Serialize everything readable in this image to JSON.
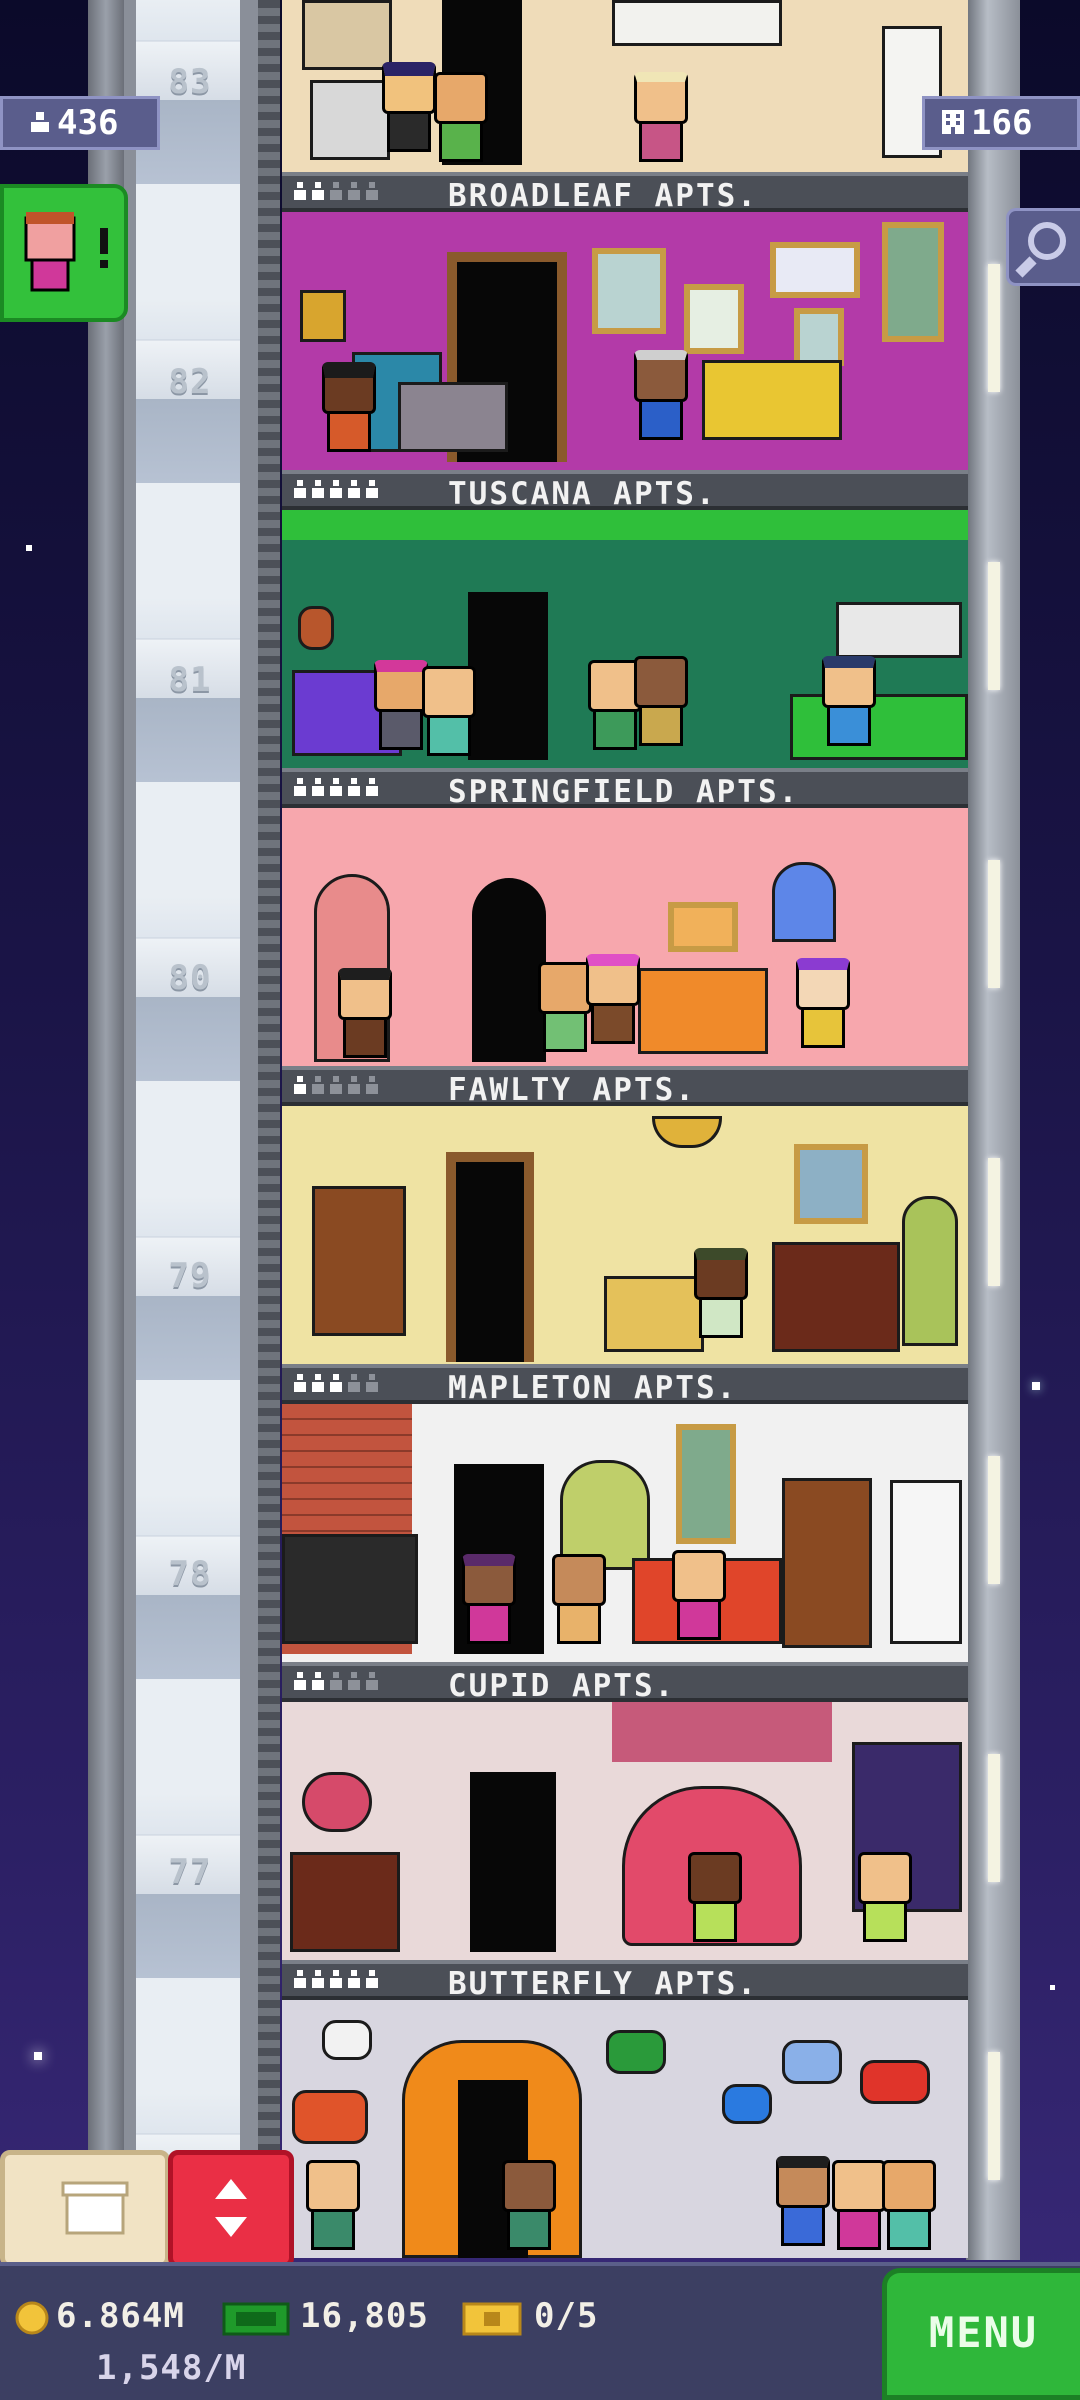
{
  "hud": {
    "population": "436",
    "floor_count": "166"
  },
  "floors": [
    {
      "number": "83",
      "name": "BROADLEAF APTS.",
      "residents": 2
    },
    {
      "number": "82",
      "name": "TUSCANA APTS.",
      "residents": 5
    },
    {
      "number": "81",
      "name": "SPRINGFIELD APTS.",
      "residents": 5
    },
    {
      "number": "80",
      "name": "FAWLTY APTS.",
      "residents": 1
    },
    {
      "number": "79",
      "name": "MAPLETON APTS.",
      "residents": 3
    },
    {
      "number": "78",
      "name": "CUPID APTS.",
      "residents": 2
    },
    {
      "number": "77",
      "name": "BUTTERFLY APTS.",
      "residents": 5
    }
  ],
  "bottom_bar": {
    "coins": "6.864M",
    "income": "1,548/M",
    "bux": "16,805",
    "tickets": "0/5",
    "menu_label": "MENU"
  },
  "colors": {
    "accent_green": "#33c13b",
    "elevator_red": "#ea2f45",
    "hud_panel": "#5a5d8c"
  }
}
